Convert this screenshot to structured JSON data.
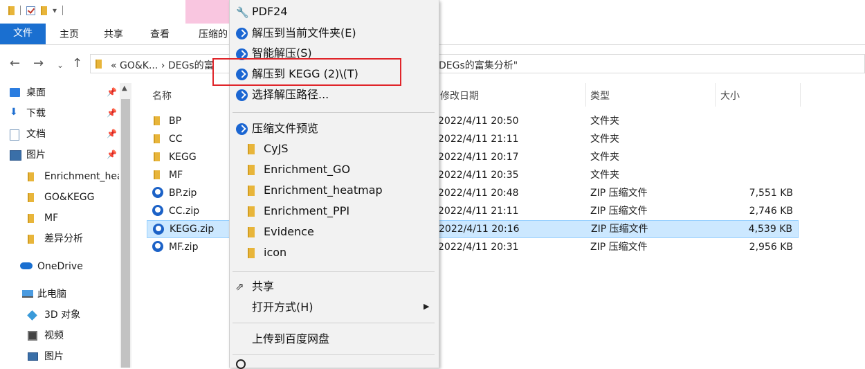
{
  "ribbon": {
    "tabs": [
      "文件",
      "主页",
      "共享",
      "查看",
      "压缩的"
    ],
    "title_fragment": "PDF24"
  },
  "address": {
    "crumbs_left": "« GO&K... › DEGs的富",
    "crumbs_right": "DEGs的富集分析\""
  },
  "sidebar": {
    "items": [
      {
        "label": "桌面",
        "icon": "desktop-icon",
        "pinned": true
      },
      {
        "label": "下载",
        "icon": "download-icon",
        "pinned": true
      },
      {
        "label": "文档",
        "icon": "document-icon",
        "pinned": true
      },
      {
        "label": "图片",
        "icon": "picture-icon",
        "pinned": true
      },
      {
        "label": "Enrichment_hea",
        "icon": "folder-icon"
      },
      {
        "label": "GO&KEGG",
        "icon": "folder-icon"
      },
      {
        "label": "MF",
        "icon": "folder-icon"
      },
      {
        "label": "差异分析",
        "icon": "folder-icon"
      },
      {
        "label": "OneDrive",
        "icon": "cloud-icon"
      },
      {
        "label": "此电脑",
        "icon": "computer-icon"
      },
      {
        "label": "3D 对象",
        "icon": "cube-icon"
      },
      {
        "label": "视频",
        "icon": "video-icon"
      },
      {
        "label": "图片",
        "icon": "picture-icon"
      }
    ]
  },
  "columns": {
    "name": "名称",
    "date": "修改日期",
    "type": "类型",
    "size": "大小"
  },
  "files": [
    {
      "name": "BP",
      "date": "2022/4/11 20:50",
      "type": "文件夹",
      "size": "",
      "kind": "folder"
    },
    {
      "name": "CC",
      "date": "2022/4/11 21:11",
      "type": "文件夹",
      "size": "",
      "kind": "folder"
    },
    {
      "name": "KEGG",
      "date": "2022/4/11 20:17",
      "type": "文件夹",
      "size": "",
      "kind": "folder"
    },
    {
      "name": "MF",
      "date": "2022/4/11 20:35",
      "type": "文件夹",
      "size": "",
      "kind": "folder"
    },
    {
      "name": "BP.zip",
      "date": "2022/4/11 20:48",
      "type": "ZIP 压缩文件",
      "size": "7,551 KB",
      "kind": "zip"
    },
    {
      "name": "CC.zip",
      "date": "2022/4/11 21:11",
      "type": "ZIP 压缩文件",
      "size": "2,746 KB",
      "kind": "zip"
    },
    {
      "name": "KEGG.zip",
      "date": "2022/4/11 20:16",
      "type": "ZIP 压缩文件",
      "size": "4,539 KB",
      "kind": "zip",
      "selected": true
    },
    {
      "name": "MF.zip",
      "date": "2022/4/11 20:31",
      "type": "ZIP 压缩文件",
      "size": "2,956 KB",
      "kind": "zip"
    }
  ],
  "menu": {
    "pdf24": "PDF24",
    "extract_here": "解压到当前文件夹(E)",
    "smart_extract": "智能解压(S)",
    "extract_to": "解压到 KEGG (2)\\(T)",
    "choose_path": "选择解压路径...",
    "preview": "压缩文件预览",
    "preview_items": [
      "CyJS",
      "Enrichment_GO",
      "Enrichment_heatmap",
      "Enrichment_PPI",
      "Evidence",
      "icon"
    ],
    "share": "共享",
    "open_with": "打开方式(H)",
    "upload": "上传到百度网盘"
  },
  "colors": {
    "accent": "#1a6fd0",
    "selection": "#cce8ff",
    "highlight": "#e0252a"
  }
}
